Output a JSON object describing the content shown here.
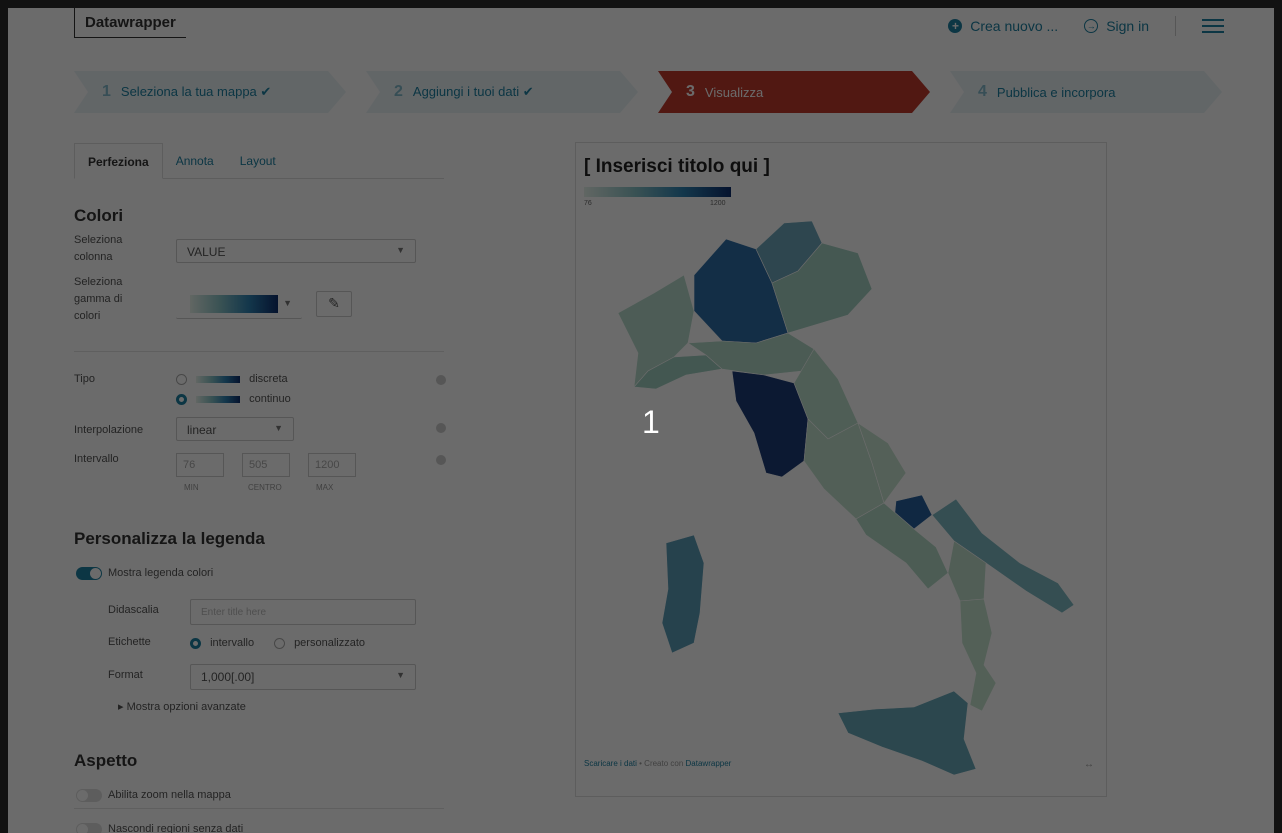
{
  "header": {
    "logo": "Datawrapper",
    "create_new": "Crea nuovo ...",
    "sign_in": "Sign in"
  },
  "steps": [
    {
      "num": "1",
      "label": "Seleziona la tua mappa ✔"
    },
    {
      "num": "2",
      "label": "Aggiungi i tuoi dati ✔"
    },
    {
      "num": "3",
      "label": "Visualizza"
    },
    {
      "num": "4",
      "label": "Pubblica e incorpora"
    }
  ],
  "tabs": [
    "Perfeziona",
    "Annota",
    "Layout"
  ],
  "colors": {
    "heading": "Colori",
    "column_label": "Seleziona colonna",
    "column_value": "VALUE",
    "palette_label": "Seleziona gamma di colori"
  },
  "type": {
    "label": "Tipo",
    "discrete": "discreta",
    "continuous": "continuo"
  },
  "interpolation": {
    "label": "Interpolazione",
    "value": "linear"
  },
  "interval": {
    "label": "Intervallo",
    "min": "76",
    "center": "505",
    "max": "1200",
    "min_label": "MIN",
    "center_label": "CENTRO",
    "max_label": "MAX"
  },
  "legend": {
    "heading": "Personalizza la legenda",
    "show_label": "Mostra legenda colori",
    "caption_label": "Didascalia",
    "caption_placeholder": "Enter title here",
    "labels_label": "Etichette",
    "labels_interval": "intervallo",
    "labels_custom": "personalizzato",
    "format_label": "Format",
    "format_value": "1,000[.00]",
    "advanced": "▸ Mostra opzioni avanzate"
  },
  "appearance": {
    "heading": "Aspetto",
    "zoom": "Abilita zoom nella mappa",
    "hide_regions": "Nascondi regioni senza dati"
  },
  "preview": {
    "title": "[ Inserisci titolo qui ]",
    "legend_min": "76",
    "legend_max": "1200",
    "footer_link": "Scaricare i dati",
    "footer_sep": " • Creato con ",
    "footer_brand": "Datawrapper"
  },
  "overlay_number": "1",
  "accent_color": "#1d81a2",
  "active_step_color": "#c0392b"
}
